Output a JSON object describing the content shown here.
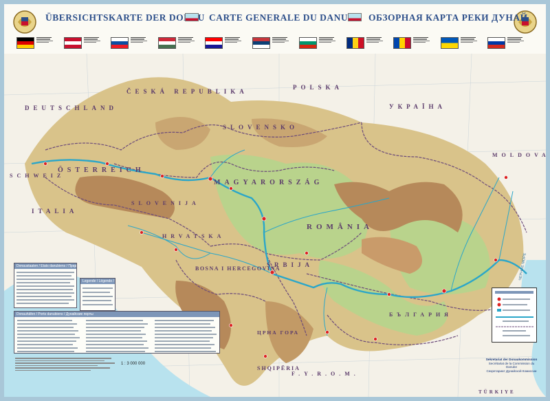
{
  "header": {
    "titles": [
      "ÜBERSICHTSKARTE DER DONAU",
      "CARTE GENERALE DU DANUBE",
      "ОБЗОРНАЯ КАРТА РЕКИ ДУНАЙ"
    ],
    "flags": [
      {
        "country": "Germany",
        "colors": [
          "#000000",
          "#dd0000",
          "#ffce00"
        ],
        "style": "h3"
      },
      {
        "country": "Austria",
        "colors": [
          "#c8102e",
          "#ffffff",
          "#c8102e"
        ],
        "style": "h3"
      },
      {
        "country": "Slovakia",
        "colors": [
          "#ffffff",
          "#0b4ea2",
          "#ee1c25"
        ],
        "style": "h3"
      },
      {
        "country": "Hungary",
        "colors": [
          "#ce2939",
          "#ffffff",
          "#477050"
        ],
        "style": "h3"
      },
      {
        "country": "Croatia",
        "colors": [
          "#ff0000",
          "#ffffff",
          "#171796"
        ],
        "style": "h3"
      },
      {
        "country": "Serbia",
        "colors": [
          "#c6363c",
          "#0c4076",
          "#ffffff"
        ],
        "style": "h3"
      },
      {
        "country": "Bulgaria",
        "colors": [
          "#ffffff",
          "#00966e",
          "#d62612"
        ],
        "style": "h3"
      },
      {
        "country": "Romania",
        "colors": [
          "#002b7f",
          "#fcd116",
          "#ce1126"
        ],
        "style": "v3"
      },
      {
        "country": "Moldova",
        "colors": [
          "#0046ae",
          "#ffd200",
          "#cc092f"
        ],
        "style": "v3"
      },
      {
        "country": "Ukraine",
        "colors": [
          "#0057b7",
          "#ffd700"
        ],
        "style": "h2"
      },
      {
        "country": "Russia",
        "colors": [
          "#ffffff",
          "#0039a6",
          "#d52b1e"
        ],
        "style": "h3"
      }
    ]
  },
  "map": {
    "country_labels": [
      "ČESKÁ REPUBLIKA",
      "POLSKA",
      "DEUTSCHLAND",
      "SLOVENSKO",
      "УКРАЇНА",
      "ÖSTERREICH",
      "SCHWEIZ",
      "MOLDOVA",
      "MAGYARORSZÁG",
      "ITALIA",
      "SLOVENIJA",
      "ROMÂNIA",
      "HRVATSKA",
      "SRBIJA",
      "BOSNA I HERCEGOVINA",
      "ЦРНА ГОРА",
      "БЪЛГАРИЯ",
      "SHQIPËRIA",
      "F.Y.R.O.M.",
      "TÜRKIYE"
    ],
    "sea_label": "ЧЕРНОЕ МОРЕ",
    "colors": {
      "lowland": "#b9d38c",
      "hills": "#d9c38a",
      "mountains": "#b6895a",
      "water": "#b8e2ee",
      "river": "#2aa6c9",
      "border": "#6b4a7a",
      "outside": "#f4f1e8"
    }
  },
  "legend": {
    "header_1": "Donaustaaten / Etats danubiens / Придунайские государства",
    "header_2": "Legende / Légende / Условные обозначения",
    "header_3": "Donauhäfen / Ports danubiens / Дунайские порты"
  },
  "scale": "1 : 3 000 000",
  "commission": [
    "Sekretariat der Donaukommission",
    "Secrétariat de la Commission du Danube",
    "Секретариат Дунайской Комиссии"
  ]
}
